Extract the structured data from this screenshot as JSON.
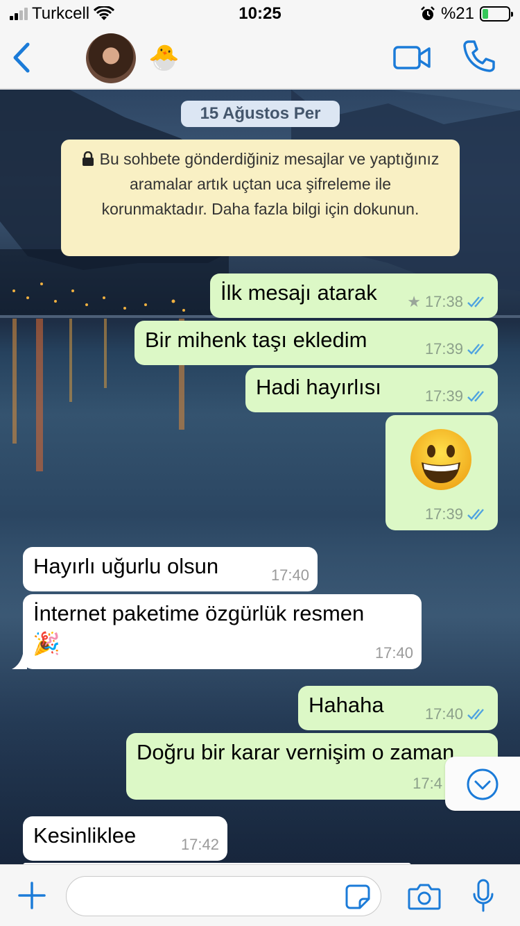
{
  "status_bar": {
    "carrier": "Turkcell",
    "time": "10:25",
    "battery": "%21",
    "battery_level": 0.21
  },
  "header": {
    "contact_emoji": "🐣"
  },
  "chat": {
    "date": "15 Ağustos Per",
    "encryption_notice": "Bu sohbete gönderdiğiniz mesajlar ve yaptığınız aramalar artık uçtan uca şifreleme ile korunmaktadır. Daha fazla bilgi için dokunun.",
    "messages": [
      {
        "dir": "out",
        "text": "İlk mesajı atarak",
        "time": "17:38",
        "starred": true
      },
      {
        "dir": "out",
        "text": "Bir mihenk taşı ekledim",
        "time": "17:39"
      },
      {
        "dir": "out",
        "text": "Hadi hayırlısı",
        "time": "17:39"
      },
      {
        "dir": "out",
        "text": "😀",
        "time": "17:39"
      },
      {
        "dir": "in",
        "text": "Hayırlı uğurlu olsun",
        "time": "17:40"
      },
      {
        "dir": "in",
        "text": "İnternet paketime özgürlük resmen",
        "emoji": "🎉",
        "time": "17:40"
      },
      {
        "dir": "out",
        "text": "Hahaha",
        "time": "17:40"
      },
      {
        "dir": "out",
        "text": "Doğru bir karar vernişim o zaman",
        "time": "17:4"
      },
      {
        "dir": "in",
        "text": "Kesinliklee",
        "time": "17:42"
      }
    ]
  },
  "colors": {
    "accent": "#1b7bd8",
    "outgoing": "#dcf8c6",
    "incoming": "#ffffff",
    "notice": "#f9f0c4",
    "read_ticks": "#4fa3e0"
  }
}
